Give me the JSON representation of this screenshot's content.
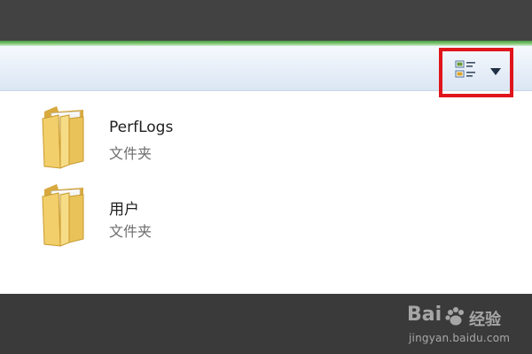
{
  "toolbar": {
    "view_icon": "details-view-icon",
    "dropdown_icon": "chevron-down-icon",
    "highlight_color": "#e0141b"
  },
  "files": [
    {
      "name": "PerfLogs",
      "type": "文件夹",
      "icon": "folder-icon"
    },
    {
      "name": "用户",
      "type": "文件夹",
      "icon": "folder-icon"
    }
  ],
  "colors": {
    "accent_green": "#6bb85e",
    "folder_yellow": "#f2cf6a"
  },
  "watermark": {
    "logo": "Bai",
    "logo_icon": "paw-icon",
    "cn": "经验",
    "url": "jingyan.baidu.com"
  }
}
